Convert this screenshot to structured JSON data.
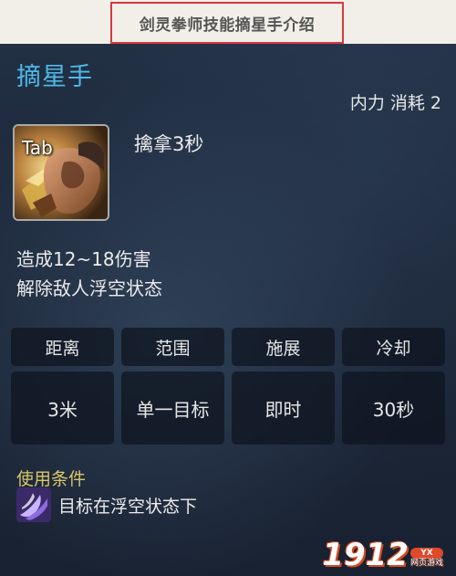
{
  "banner": {
    "caption": "剑灵拳师技能摘星手介绍"
  },
  "skill": {
    "name": "摘星手",
    "cost": "内力 消耗 2",
    "key_label": "Tab",
    "cast_line": "擒拿3秒",
    "effects": [
      "造成12~18伤害",
      "解除敌人浮空状态"
    ]
  },
  "stats": {
    "headers": [
      "距离",
      "范围",
      "施展",
      "冷却"
    ],
    "values": [
      "3米",
      "单一目标",
      "即时",
      "30秒"
    ]
  },
  "condition": {
    "title": "使用条件",
    "text": "目标在浮空状态下",
    "icon": "airborne-status-icon"
  },
  "watermark": {
    "number": "1912",
    "badge": "YX",
    "subtitle": "网页游戏"
  },
  "colors": {
    "skill_name": "#4fb8e8",
    "condition_title": "#d8c66a",
    "banner_border": "#d9363e"
  }
}
